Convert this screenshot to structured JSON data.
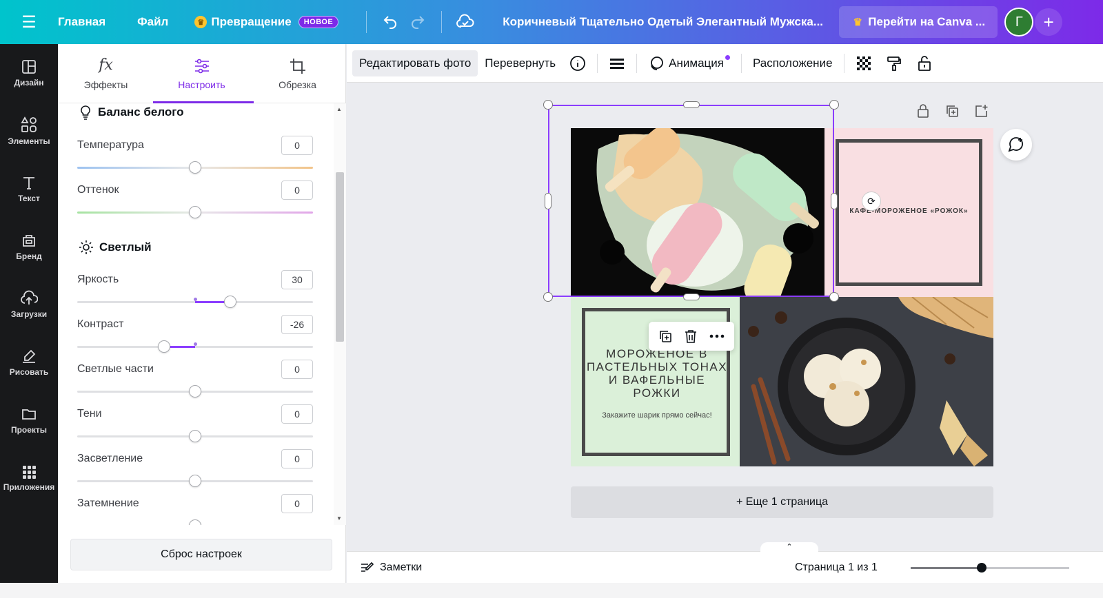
{
  "topbar": {
    "home": "Главная",
    "file": "Файл",
    "magic": "Превращение",
    "new_badge": "НОВОЕ",
    "title": "Коричневый Тщательно Одетый Элегантный Мужска...",
    "upgrade": "Перейти на Canva ...",
    "avatar_letter": "Г",
    "plus": "+"
  },
  "rail": {
    "items": [
      {
        "label": "Дизайн",
        "icon": "layout-icon"
      },
      {
        "label": "Элементы",
        "icon": "shapes-icon"
      },
      {
        "label": "Текст",
        "icon": "text-icon"
      },
      {
        "label": "Бренд",
        "icon": "brand-icon"
      },
      {
        "label": "Загрузки",
        "icon": "upload-icon"
      },
      {
        "label": "Рисовать",
        "icon": "draw-icon"
      },
      {
        "label": "Проекты",
        "icon": "folder-icon"
      },
      {
        "label": "Приложения",
        "icon": "apps-icon"
      }
    ]
  },
  "panel": {
    "tabs": [
      "Эффекты",
      "Настроить",
      "Обрезка"
    ],
    "active_tab": "Настроить",
    "white_balance_title": "Баланс белого",
    "light_title": "Светлый",
    "rows": [
      {
        "label": "Температура",
        "value": "0",
        "level": 0
      },
      {
        "label": "Оттенок",
        "value": "0",
        "level": 0
      },
      {
        "label": "Яркость",
        "value": "30",
        "level": 30
      },
      {
        "label": "Контраст",
        "value": "-26",
        "level": -26
      },
      {
        "label": "Светлые части",
        "value": "0",
        "level": 0
      },
      {
        "label": "Тени",
        "value": "0",
        "level": 0
      },
      {
        "label": "Засветление",
        "value": "0",
        "level": 0
      },
      {
        "label": "Затемнение",
        "value": "0",
        "level": 0
      }
    ],
    "reset": "Сброс настроек"
  },
  "toolbar": {
    "edit_photo": "Редактировать фото",
    "flip": "Перевернуть",
    "animation": "Анимация",
    "position": "Расположение"
  },
  "canvas": {
    "cafe": "КАФЕ-МОРОЖЕНОЕ «РОЖОК»",
    "headline": "МОРОЖЕНОЕ В ПАСТЕЛЬНЫХ ТОНАХ И ВАФЕЛЬНЫЕ РОЖКИ",
    "subline": "Закажите шарик прямо сейчас!",
    "add_page": "+ Еще 1 страница"
  },
  "footer": {
    "notes": "Заметки",
    "page_indicator": "Страница 1 из 1",
    "zoom_level": 0.45
  },
  "colors": {
    "accent": "#7d2ae8",
    "pink": "#f9dfe2",
    "mint": "#dbf0d9"
  }
}
